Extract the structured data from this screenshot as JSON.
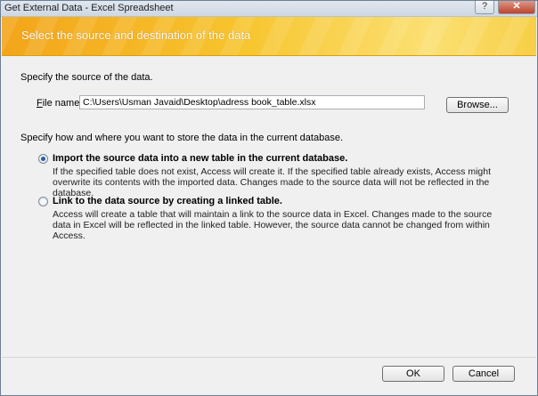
{
  "window": {
    "title": "Get External Data - Excel Spreadsheet",
    "help_label": "?",
    "close_label": "✕"
  },
  "banner": {
    "heading": "Select the source and destination of the data"
  },
  "source": {
    "label": "Specify the source of the data.",
    "file_name_label_access": "F",
    "file_name_label_rest": "ile name:",
    "file_name_value": "C:\\Users\\Usman Javaid\\Desktop\\adress book_table.xlsx",
    "browse_label": "Browse..."
  },
  "destination": {
    "label": "Specify how and where you want to store the data in the current database.",
    "options": [
      {
        "title": "Import the source data into a new table in the current database.",
        "description": "If the specified table does not exist, Access will create it. If the specified table already exists, Access might overwrite its contents with the imported data. Changes made to the source data will not be reflected in the database.",
        "selected": true
      },
      {
        "title": "Link to the data source by creating a linked table.",
        "description": "Access will create a table that will maintain a link to the source data in Excel. Changes made to the source data in Excel will be reflected in the linked table. However, the source data cannot be changed from within Access.",
        "selected": false
      }
    ]
  },
  "footer": {
    "ok_label": "OK",
    "cancel_label": "Cancel"
  },
  "colors": {
    "banner_start": "#f3a51a",
    "banner_end": "#f7cf46",
    "radio_dot": "#2d5e9c"
  }
}
